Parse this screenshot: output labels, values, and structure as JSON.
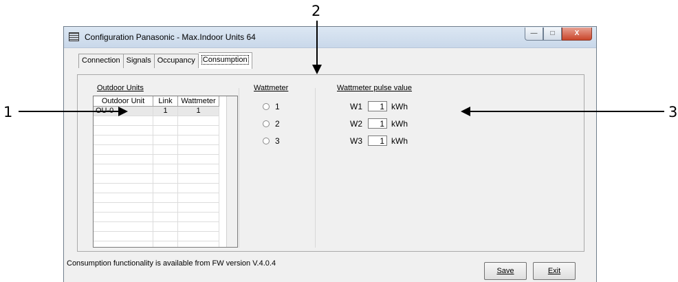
{
  "callouts": [
    "1",
    "2",
    "3"
  ],
  "window": {
    "title": "Configuration Panasonic - Max.Indoor Units 64",
    "controls": {
      "minimize": "—",
      "maximize": "□",
      "close": "X"
    }
  },
  "tabs": [
    "Connection",
    "Signals",
    "Occupancy",
    "Consumption"
  ],
  "active_tab": "Consumption",
  "outdoor_units": {
    "label": "Outdoor Units",
    "columns": [
      "Outdoor Unit",
      "Link",
      "Wattmeter"
    ],
    "rows": [
      {
        "unit": "OU-0",
        "link": "1",
        "wattmeter": "1"
      }
    ]
  },
  "wattmeter": {
    "label": "Wattmeter",
    "options": [
      "1",
      "2",
      "3"
    ]
  },
  "pulse": {
    "label": "Wattmeter pulse value",
    "rows": [
      {
        "name": "W1",
        "value": "1",
        "unit": "kWh"
      },
      {
        "name": "W2",
        "value": "1",
        "unit": "kWh"
      },
      {
        "name": "W3",
        "value": "1",
        "unit": "kWh"
      }
    ]
  },
  "status_text": "Consumption functionality is available from FW version V.4.0.4",
  "buttons": {
    "save": "Save",
    "exit": "Exit"
  }
}
